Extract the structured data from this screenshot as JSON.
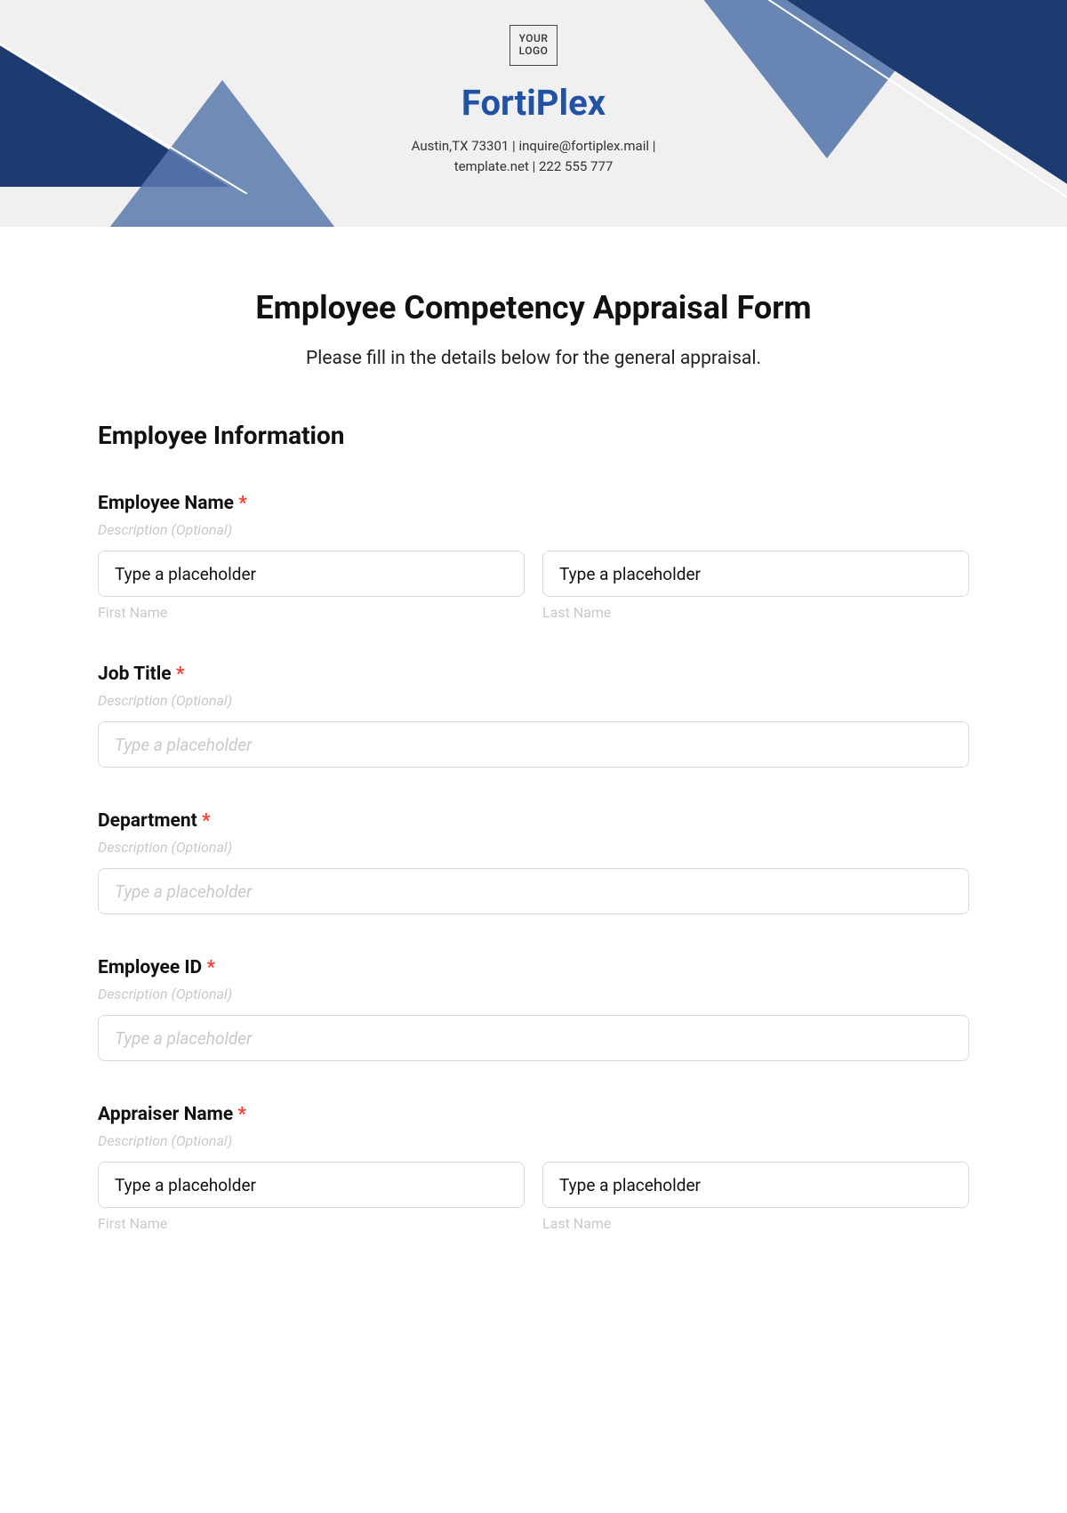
{
  "header": {
    "logo_line1": "YOUR",
    "logo_line2": "LOGO",
    "company": "FortiPlex",
    "contact_line1": "Austin,TX 73301 | inquire@fortiplex.mail |",
    "contact_line2": "template.net | 222 555 777"
  },
  "form": {
    "title": "Employee Competency Appraisal Form",
    "subtitle": "Please fill in the details below for the general appraisal.",
    "section_heading": "Employee Information",
    "desc_placeholder": "Description (Optional)",
    "placeholder_text": "Type a placeholder",
    "sub_first": "First Name",
    "sub_last": "Last Name",
    "required_mark": "*",
    "fields": {
      "employee_name": {
        "label": "Employee Name"
      },
      "job_title": {
        "label": "Job Title"
      },
      "department": {
        "label": "Department"
      },
      "employee_id": {
        "label": "Employee ID"
      },
      "appraiser_name": {
        "label": "Appraiser Name"
      }
    }
  }
}
